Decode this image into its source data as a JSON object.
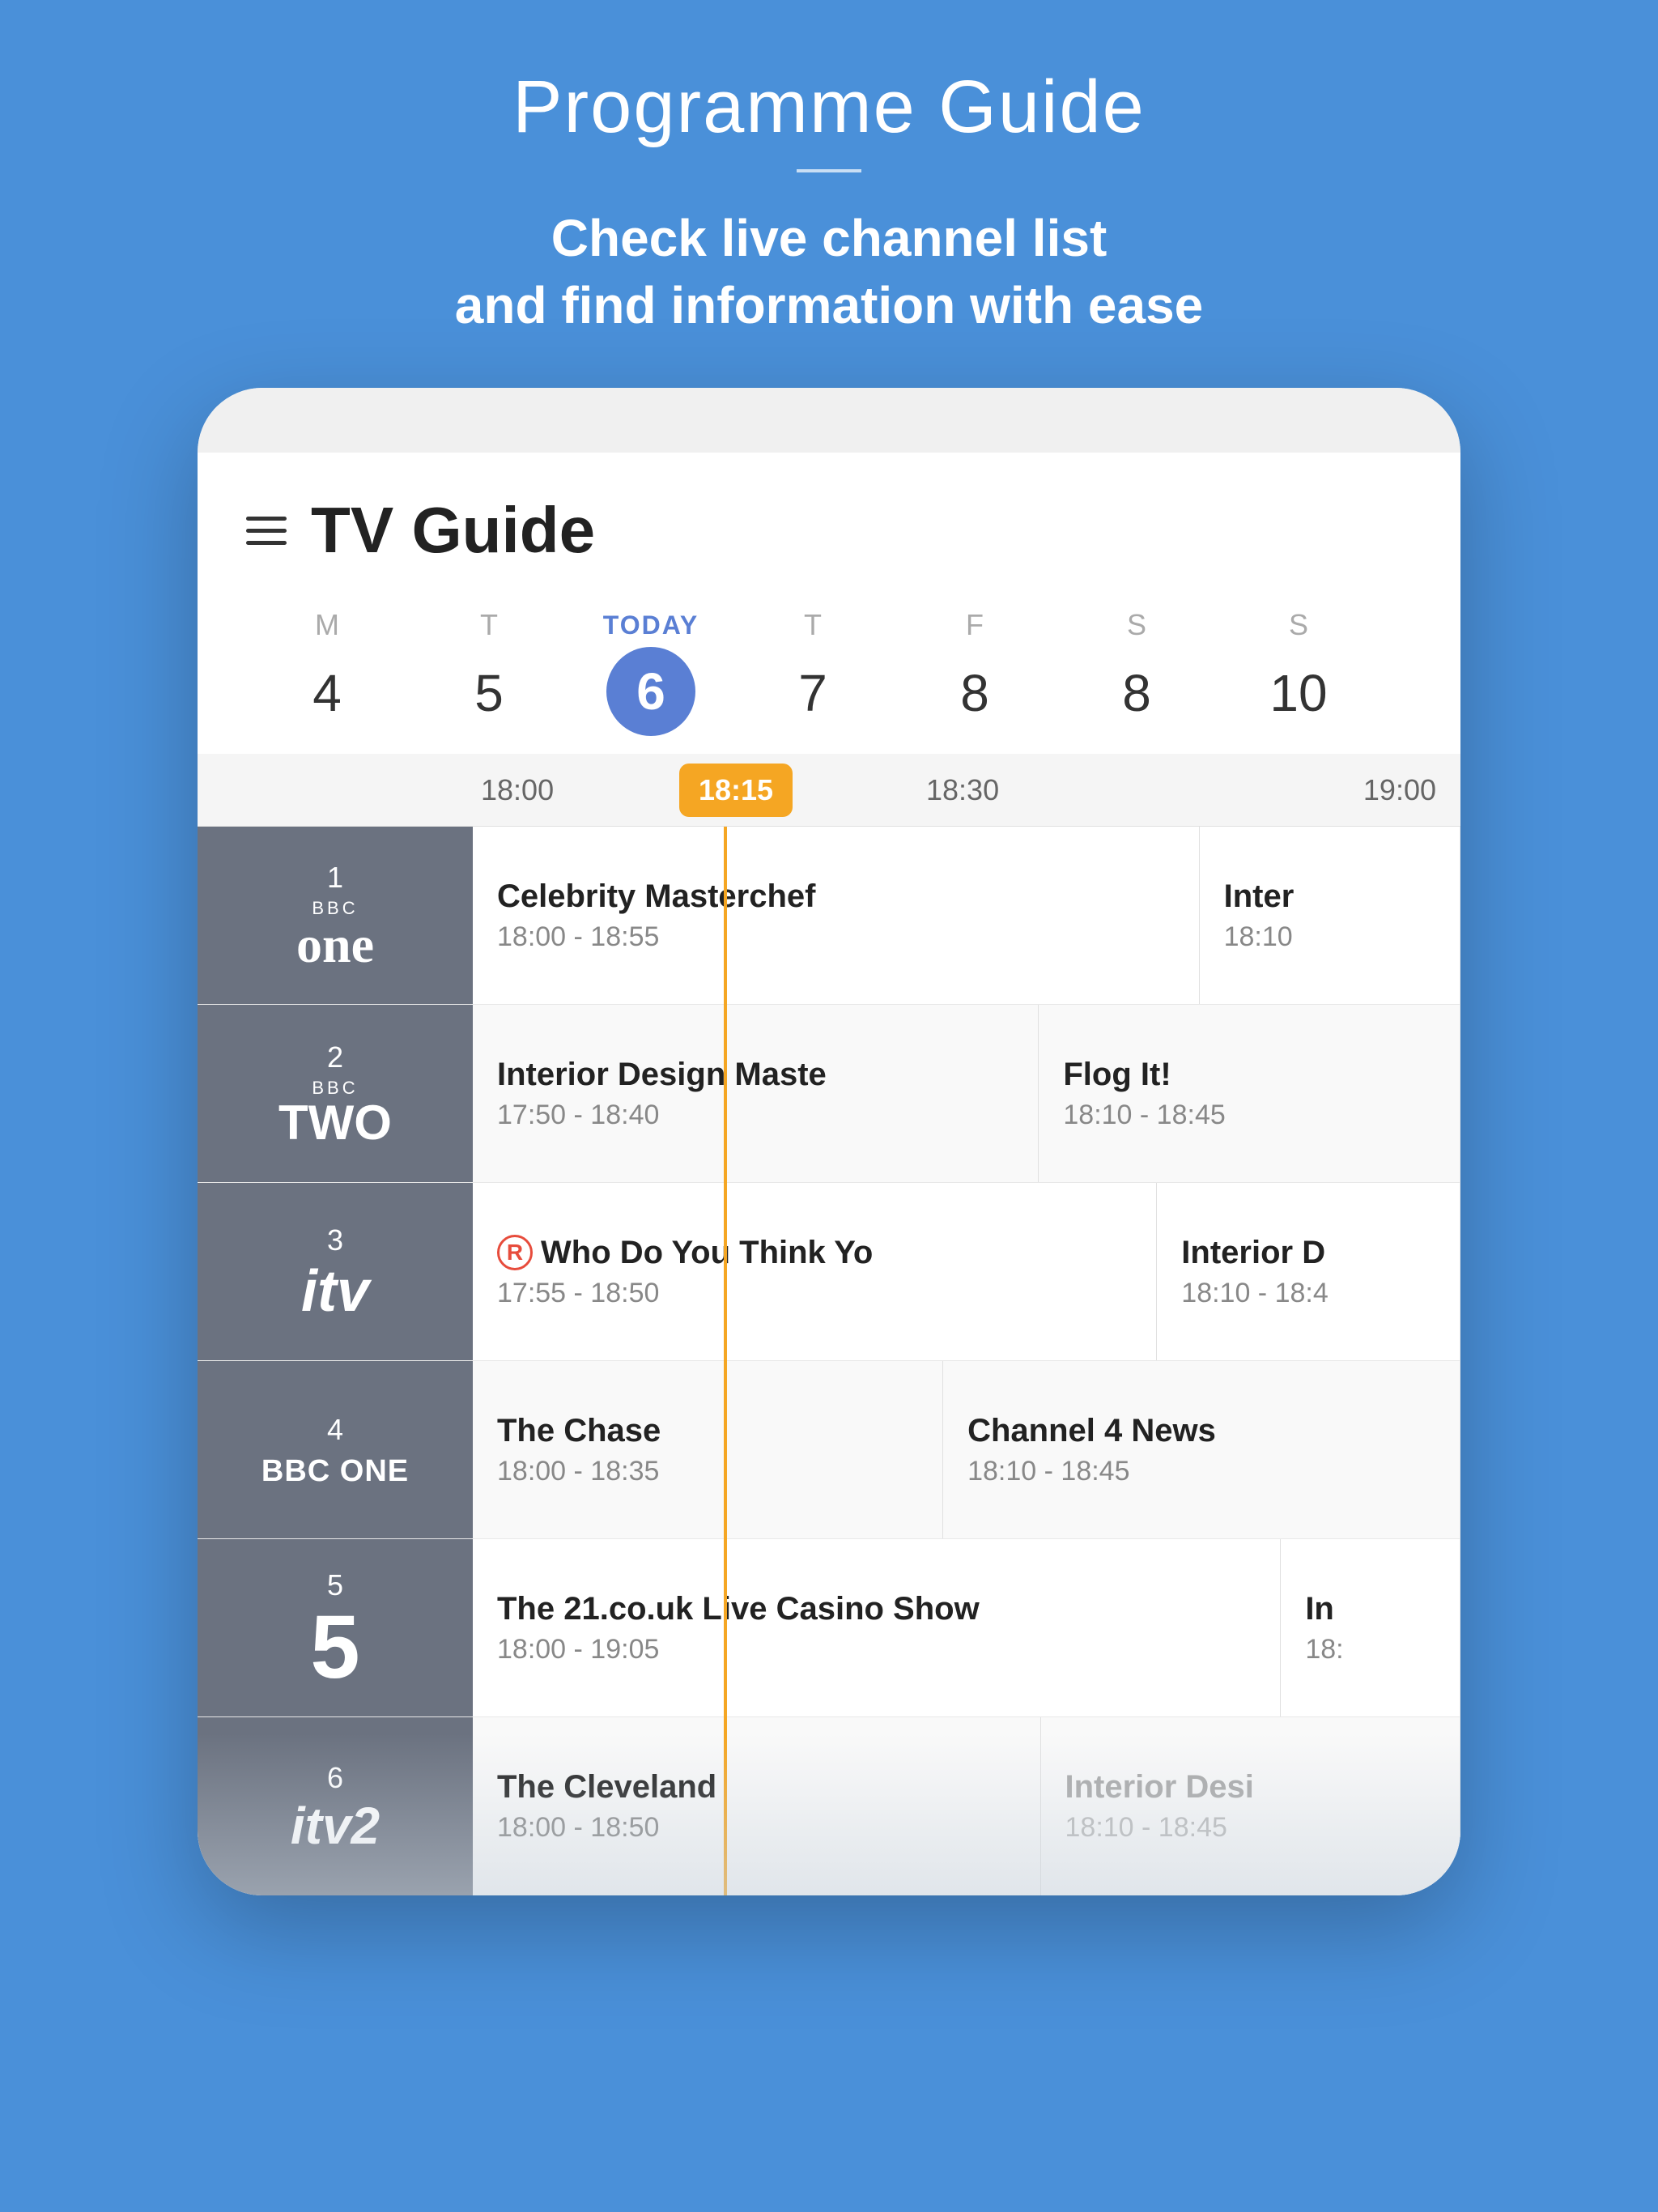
{
  "page": {
    "title": "Programme Guide",
    "subtitle_line1": "Check live channel list",
    "subtitle_line2": "and find information with ease"
  },
  "tv_guide": {
    "title": "TV Guide",
    "current_time": "18:15",
    "days": [
      {
        "letter": "M",
        "number": "4",
        "today": false
      },
      {
        "letter": "T",
        "number": "5",
        "today": false
      },
      {
        "letter": "TODAY",
        "number": "6",
        "today": true
      },
      {
        "letter": "T",
        "number": "7",
        "today": false
      },
      {
        "letter": "F",
        "number": "8",
        "today": false
      },
      {
        "letter": "S",
        "number": "8",
        "today": false
      },
      {
        "letter": "S",
        "number": "10",
        "today": false
      }
    ],
    "timeline_labels": [
      {
        "label": "18:00",
        "offset": 0
      },
      {
        "label": "18:15",
        "offset": 310,
        "current": true
      },
      {
        "label": "18:30",
        "offset": 620
      },
      {
        "label": "19:00",
        "offset": 1180
      }
    ],
    "channels": [
      {
        "number": "1",
        "logo_line1": "BBC",
        "logo_line2": "one",
        "style": "bbc-one",
        "programmes": [
          {
            "title": "Celebrity Masterchef",
            "time": "18:00 - 18:55",
            "width": "wide"
          },
          {
            "title": "Inter",
            "time": "18:10",
            "width": "narrow"
          }
        ]
      },
      {
        "number": "2",
        "logo_line1": "BBC",
        "logo_line2": "TWO",
        "style": "bbc-two",
        "programmes": [
          {
            "title": "Interior Design Maste",
            "time": "17:50 - 18:40",
            "width": "wide"
          },
          {
            "title": "Flog It!",
            "time": "18:10 - 18:45",
            "width": "medium"
          }
        ]
      },
      {
        "number": "3",
        "logo_line1": "itv",
        "style": "itv",
        "programmes": [
          {
            "title": "Who Do You Think Yo",
            "time": "17:55 - 18:50",
            "width": "wide",
            "repeat": true
          },
          {
            "title": "Interior D",
            "time": "18:10 - 18:4",
            "width": "narrow"
          }
        ]
      },
      {
        "number": "4",
        "logo_line1": "BBC ONE",
        "style": "bbc-one-text",
        "programmes": [
          {
            "title": "The Chase",
            "time": "18:00 - 18:35",
            "width": "medium"
          },
          {
            "title": "Channel 4 News",
            "time": "18:10 - 18:45",
            "width": "medium"
          }
        ]
      },
      {
        "number": "5",
        "logo_line1": "5",
        "style": "five",
        "programmes": [
          {
            "title": "The 21.co.uk Live Casino Show",
            "time": "18:00 - 19:05",
            "width": "wide"
          },
          {
            "title": "In",
            "time": "18:",
            "width": "very-narrow"
          }
        ]
      },
      {
        "number": "6",
        "logo_line1": "itv2",
        "style": "itv2",
        "programmes": [
          {
            "title": "The Cleveland",
            "time": "18:00 - 18:50",
            "width": "wide"
          },
          {
            "title": "Interior Desi",
            "time": "18:10 - 18:45",
            "width": "medium"
          }
        ]
      }
    ]
  }
}
